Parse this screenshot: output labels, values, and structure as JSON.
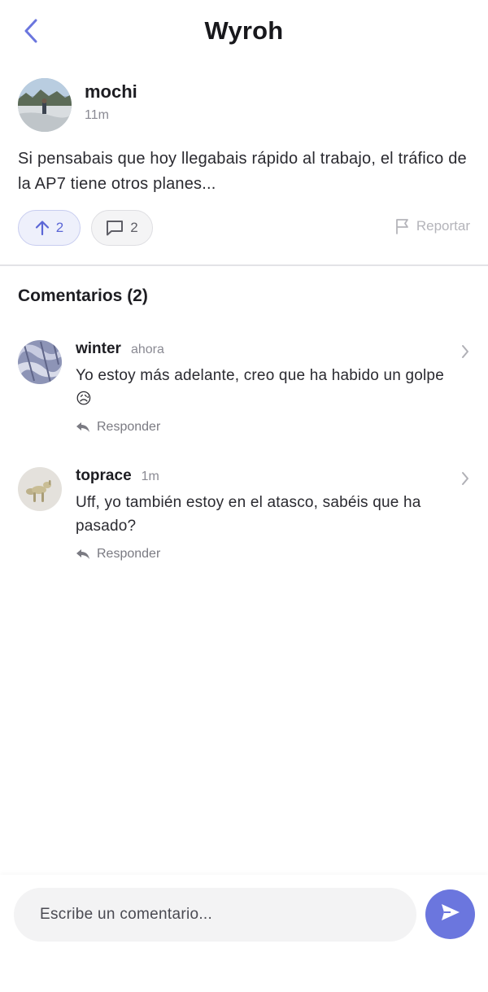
{
  "header": {
    "title": "Wyroh"
  },
  "post": {
    "author": "mochi",
    "time": "11m",
    "text": "Si pensabais que hoy llegabais rápido al trabajo, el tráfico de la AP7 tiene otros planes...",
    "upvotes": "2",
    "comment_count": "2",
    "report_label": "Reportar"
  },
  "comments_section": {
    "title": "Comentarios (2)",
    "items": [
      {
        "author": "winter",
        "time": "ahora",
        "text": "Yo estoy más adelante, creo que ha habido un golpe 😥",
        "reply_label": "Responder"
      },
      {
        "author": "toprace",
        "time": "1m",
        "text": "Uff, yo también estoy en el atasco, sabéis que ha pasado?",
        "reply_label": "Responder"
      }
    ]
  },
  "composer": {
    "placeholder": "Escribe un comentario..."
  },
  "colors": {
    "accent": "#6b76de",
    "upvote_bg": "#eef0fb",
    "text": "#2a2a30",
    "muted": "#8a8a93"
  }
}
